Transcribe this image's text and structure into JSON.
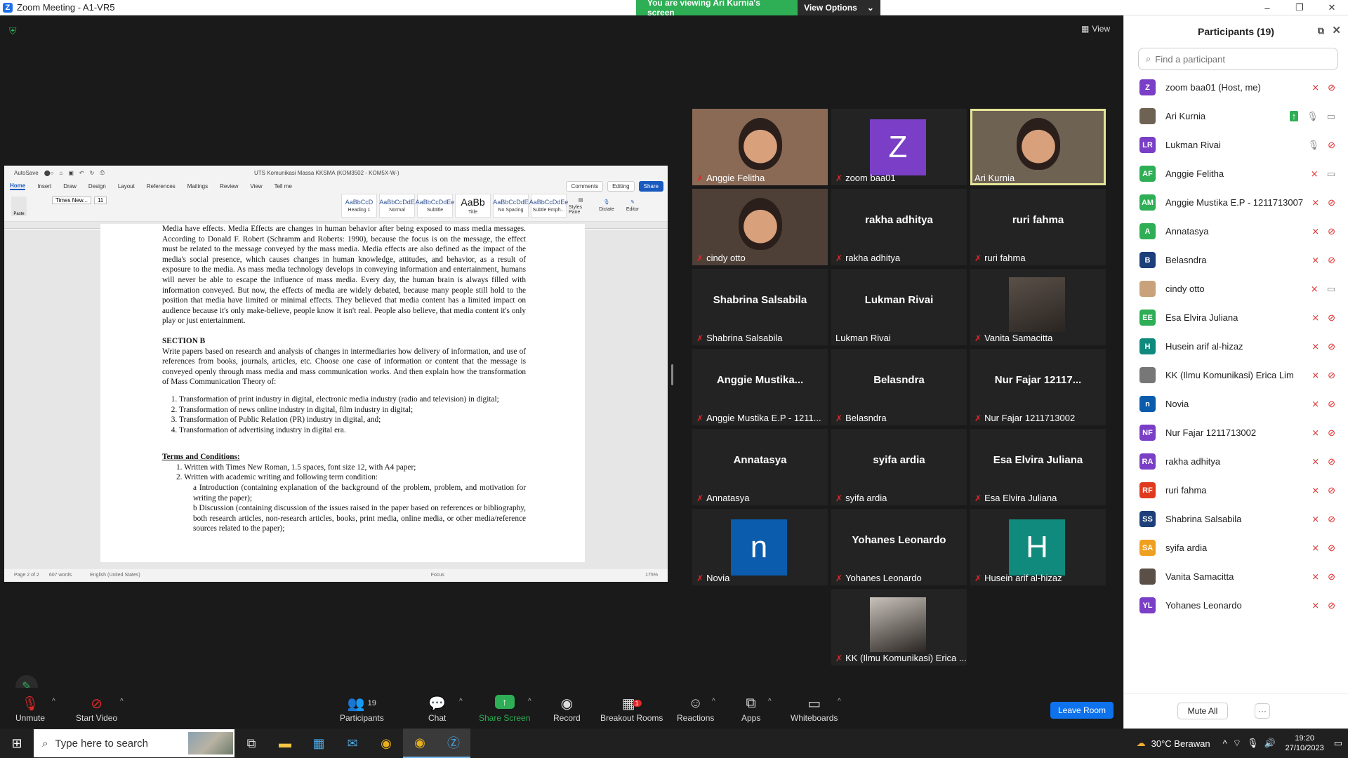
{
  "titlebar": {
    "title": "Zoom Meeting - A1-VR5",
    "minimize": "–",
    "maximize": "❐",
    "close": "✕"
  },
  "sharebar": {
    "viewing": "You are viewing Ari Kurnia's screen",
    "view_options": "View Options"
  },
  "stage": {
    "view_label": "View"
  },
  "doc": {
    "autosave": "AutoSave",
    "title": "UTS Komunikasi Massa KKSMA (KOM3502 - KOM5X-W-)",
    "tabs": [
      "Home",
      "Insert",
      "Draw",
      "Design",
      "Layout",
      "References",
      "Mailings",
      "Review",
      "View",
      "Tell me"
    ],
    "comments": "Comments",
    "editing": "Editing",
    "share": "Share",
    "font": "Times New...",
    "size": "11",
    "styles": [
      {
        "sample": "AaBbCcD",
        "name": "Heading 1"
      },
      {
        "sample": "AaBbCcDdE",
        "name": "Normal"
      },
      {
        "sample": "AaBbCcDdEe",
        "name": "Subtitle"
      },
      {
        "sample": "AaBb",
        "name": "Title"
      },
      {
        "sample": "AaBbCcDdE",
        "name": "No Spacing"
      },
      {
        "sample": "AaBbCcDdEe",
        "name": "Subtle Emph..."
      }
    ],
    "styles_pane": "Styles Pane",
    "dictate": "Dictate",
    "editor": "Editor",
    "para1": "Media have effects. Media Effects are changes in human behavior after being exposed to mass media messages. According to Donald F. Robert (Schramm and Roberts: 1990), because the focus is on the message, the effect must be related to the message conveyed by the mass media. Media effects are also defined as the impact of the media's social presence, which causes changes in human knowledge, attitudes, and behavior, as a result of exposure to the media. As mass media technology develops in conveying information and entertainment, humans will never be able to escape the influence of mass media. Every day, the human brain is always filled with information conveyed. But now, the effects of media are widely debated, because many people still hold to the position that media have limited or minimal effects. They believed that media content has a limited impact on audience because it's only make-believe, people know it isn't real. People also believe, that media content it's only play or just entertainment.",
    "section_b": "SECTION B",
    "para2": "Write papers based on research and analysis of changes in intermediaries how delivery of information, and use of references from books, journals, articles, etc. Choose one case of information or content that the message is conveyed openly through mass media and mass communication works. And then explain how the transformation of Mass Communication Theory of:",
    "items": [
      "Transformation of print industry in digital, electronic media industry (radio and television) in digital;",
      "Transformation of news online industry in digital, film industry in digital;",
      "Transformation of Public Relation (PR) industry in digital, and;",
      "Transformation of advertising industry in digital era."
    ],
    "terms": "Terms and Conditions:",
    "t1": "1.   Written with Times New Roman, 1.5 spaces, font size 12, with A4 paper;",
    "t2": "2.   Written with academic writing and following term condition:",
    "ta": "a    Introduction (containing explanation of the background of the problem, problem, and motivation for writing the paper);",
    "tb": "b    Discussion (containing discussion of the issues raised in the paper based on references or bibliography, both research articles, non-research articles, books, print media, online media, or other media/reference sources related to the paper);",
    "status_page": "Page 2 of 2",
    "status_words": "607 words",
    "status_lang": "English (United States)",
    "status_focus": "Focus",
    "status_zoom": "175%"
  },
  "gallery": [
    {
      "name": "Anggie Felitha",
      "big": "",
      "type": "video",
      "bg": "#8a6a55",
      "muted": true
    },
    {
      "name": "zoom baa01",
      "big": "",
      "type": "avatar",
      "letter": "Z",
      "bg": "#7a3fc6",
      "muted": true
    },
    {
      "name": "Ari Kurnia",
      "big": "",
      "type": "video",
      "bg": "#6e6253",
      "muted": false,
      "active": true
    },
    {
      "name": "cindy otto",
      "big": "",
      "type": "video",
      "bg": "#4e4037",
      "muted": true
    },
    {
      "name": "rakha adhitya",
      "big": "rakha adhitya",
      "type": "text",
      "muted": true
    },
    {
      "name": "ruri fahma",
      "big": "ruri fahma",
      "type": "text",
      "muted": true
    },
    {
      "name": "Shabrina Salsabila",
      "big": "Shabrina Salsabila",
      "type": "text",
      "muted": true
    },
    {
      "name": "Lukman Rivai",
      "big": "Lukman Rivai",
      "type": "text",
      "muted": false
    },
    {
      "name": "Vanita Samacitta",
      "big": "",
      "type": "photo",
      "bg": "#5a5048",
      "muted": true
    },
    {
      "name": "Anggie Mustika E.P - 1211...",
      "big": "Anggie  Mustika...",
      "type": "text",
      "muted": true
    },
    {
      "name": "Belasndra",
      "big": "Belasndra",
      "type": "text",
      "muted": true
    },
    {
      "name": "Nur Fajar 1211713002",
      "big": "Nur Fajar 12117...",
      "type": "text",
      "muted": true
    },
    {
      "name": "Annatasya",
      "big": "Annatasya",
      "type": "text",
      "muted": true
    },
    {
      "name": "syifa ardia",
      "big": "syifa ardia",
      "type": "text",
      "muted": true
    },
    {
      "name": "Esa Elvira Juliana",
      "big": "Esa Elvira Juliana",
      "type": "text",
      "muted": true
    },
    {
      "name": "Novia",
      "big": "",
      "type": "avatar",
      "letter": "n",
      "bg": "#0b5cad",
      "muted": true
    },
    {
      "name": "Yohanes Leonardo",
      "big": "Yohanes Leonardo",
      "type": "text",
      "muted": true
    },
    {
      "name": "Husein arif al-hizaz",
      "big": "",
      "type": "avatar",
      "letter": "H",
      "bg": "#0f8a7c",
      "muted": true
    },
    {
      "name": "KK (Ilmu Komunikasi) Erica ...",
      "big": "",
      "type": "photo",
      "bg": "#c9c2bb",
      "muted": true
    }
  ],
  "toolbar": {
    "unmute": "Unmute",
    "start_video": "Start Video",
    "participants": "Participants",
    "participants_count": "19",
    "chat": "Chat",
    "share_screen": "Share Screen",
    "record": "Record",
    "breakout": "Breakout Rooms",
    "breakout_badge": "1",
    "reactions": "Reactions",
    "apps": "Apps",
    "whiteboards": "Whiteboards",
    "leave": "Leave Room"
  },
  "panel": {
    "title": "Participants (19)",
    "search_placeholder": "Find a participant",
    "mute_all": "Mute All",
    "more": "···",
    "participants": [
      {
        "initials": "Z",
        "name": "zoom baa01 (Host, me)",
        "color": "#7a3fc6",
        "mic": "off",
        "video": "off"
      },
      {
        "initials": "",
        "name": "Ari Kurnia",
        "color": "#6e6253",
        "mic": "on",
        "video": "on",
        "sharing": true
      },
      {
        "initials": "LR",
        "name": "Lukman Rivai",
        "color": "#7a3fc6",
        "mic": "on",
        "video": "off"
      },
      {
        "initials": "AF",
        "name": "Anggie Felitha",
        "color": "#2eae55",
        "mic": "off",
        "video": "on"
      },
      {
        "initials": "AM",
        "name": "Anggie Mustika E.P - 1211713007",
        "color": "#2eae55",
        "mic": "off",
        "video": "off"
      },
      {
        "initials": "A",
        "name": "Annatasya",
        "color": "#2eae55",
        "mic": "off",
        "video": "off"
      },
      {
        "initials": "B",
        "name": "Belasndra",
        "color": "#1d3f7a",
        "mic": "off",
        "video": "off"
      },
      {
        "initials": "",
        "name": "cindy otto",
        "color": "#c9a27b",
        "mic": "off",
        "video": "on"
      },
      {
        "initials": "EE",
        "name": "Esa Elvira Juliana",
        "color": "#2eae55",
        "mic": "off",
        "video": "off"
      },
      {
        "initials": "H",
        "name": "Husein arif al-hizaz",
        "color": "#0f8a7c",
        "mic": "off",
        "video": "off"
      },
      {
        "initials": "",
        "name": "KK (Ilmu Komunikasi) Erica Lim",
        "color": "#777777",
        "mic": "off",
        "video": "off"
      },
      {
        "initials": "n",
        "name": "Novia",
        "color": "#0b5cad",
        "mic": "off",
        "video": "off"
      },
      {
        "initials": "NF",
        "name": "Nur Fajar 1211713002",
        "color": "#7a3fc6",
        "mic": "off",
        "video": "off"
      },
      {
        "initials": "RA",
        "name": "rakha adhitya",
        "color": "#7a3fc6",
        "mic": "off",
        "video": "off"
      },
      {
        "initials": "RF",
        "name": "ruri fahma",
        "color": "#e03a1e",
        "mic": "off",
        "video": "off"
      },
      {
        "initials": "SS",
        "name": "Shabrina Salsabila",
        "color": "#1d3f7a",
        "mic": "off",
        "video": "off"
      },
      {
        "initials": "SA",
        "name": "syifa ardia",
        "color": "#f0a020",
        "mic": "off",
        "video": "off"
      },
      {
        "initials": "",
        "name": "Vanita Samacitta",
        "color": "#5a5048",
        "mic": "off",
        "video": "off"
      },
      {
        "initials": "YL",
        "name": "Yohanes Leonardo",
        "color": "#7a3fc6",
        "mic": "off",
        "video": "off"
      }
    ]
  },
  "taskbar": {
    "search": "Type here to search",
    "weather": "30°C  Berawan",
    "time": "19:20",
    "date": "27/10/2023"
  }
}
